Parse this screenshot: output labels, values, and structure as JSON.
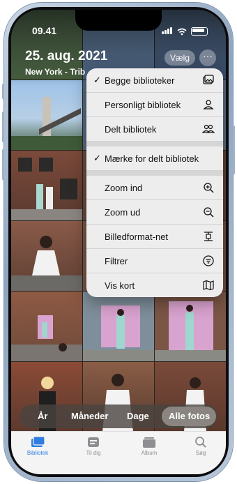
{
  "status": {
    "time": "09.41"
  },
  "header": {
    "date": "25. aug. 2021",
    "location": "New York - Trib"
  },
  "buttons": {
    "select": "Vælg",
    "more": "···"
  },
  "menu": {
    "items": [
      {
        "label": "Begge biblioteker",
        "checked": "✓",
        "icon": "photo-library-icon"
      },
      {
        "label": "Personligt bibliotek",
        "checked": "",
        "icon": "person-icon"
      },
      {
        "label": "Delt bibliotek",
        "checked": "",
        "icon": "people-icon"
      },
      {
        "label": "Mærke for delt bibliotek",
        "checked": "✓",
        "icon": ""
      },
      {
        "label": "Zoom ind",
        "checked": "",
        "icon": "zoom-in-icon"
      },
      {
        "label": "Zoom ud",
        "checked": "",
        "icon": "zoom-out-icon"
      },
      {
        "label": "Billedformat-net",
        "checked": "",
        "icon": "aspect-ratio-icon"
      },
      {
        "label": "Filtrer",
        "checked": "",
        "icon": "filter-icon"
      },
      {
        "label": "Vis kort",
        "checked": "",
        "icon": "map-icon"
      }
    ]
  },
  "segmented": {
    "items": [
      "År",
      "Måneder",
      "Dage",
      "Alle fotos"
    ],
    "selected": "Alle fotos"
  },
  "tabs": [
    {
      "label": "Bibliotek",
      "icon": "photo-library-icon",
      "active": true
    },
    {
      "label": "Til dig",
      "icon": "for-you-icon",
      "active": false
    },
    {
      "label": "Album",
      "icon": "album-icon",
      "active": false
    },
    {
      "label": "Søg",
      "icon": "search-icon",
      "active": false
    }
  ],
  "colors": {
    "accent": "#2f7de1",
    "menu_bg": "#ededed"
  }
}
